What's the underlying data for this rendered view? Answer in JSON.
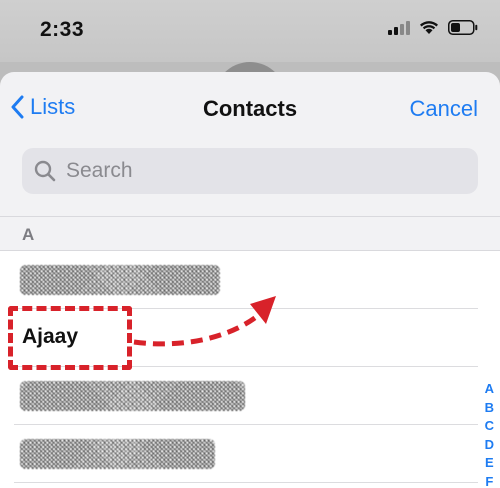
{
  "status_bar": {
    "time": "2:33",
    "icons": [
      "cellular-signal-icon",
      "wifi-icon",
      "battery-icon"
    ]
  },
  "nav": {
    "back_label": "Lists",
    "title": "Contacts",
    "cancel_label": "Cancel"
  },
  "search": {
    "placeholder": "Search",
    "value": ""
  },
  "section": {
    "header": "A"
  },
  "contacts": [
    {
      "name": "",
      "redacted": true
    },
    {
      "name": "Ajaay",
      "redacted": false,
      "highlighted": true
    },
    {
      "name": "",
      "redacted": true
    },
    {
      "name": "",
      "redacted": true
    }
  ],
  "index_letters": [
    "A",
    "B",
    "C",
    "D",
    "E",
    "F"
  ],
  "colors": {
    "accent": "#1e7cf2",
    "annotation": "#d8222a"
  }
}
